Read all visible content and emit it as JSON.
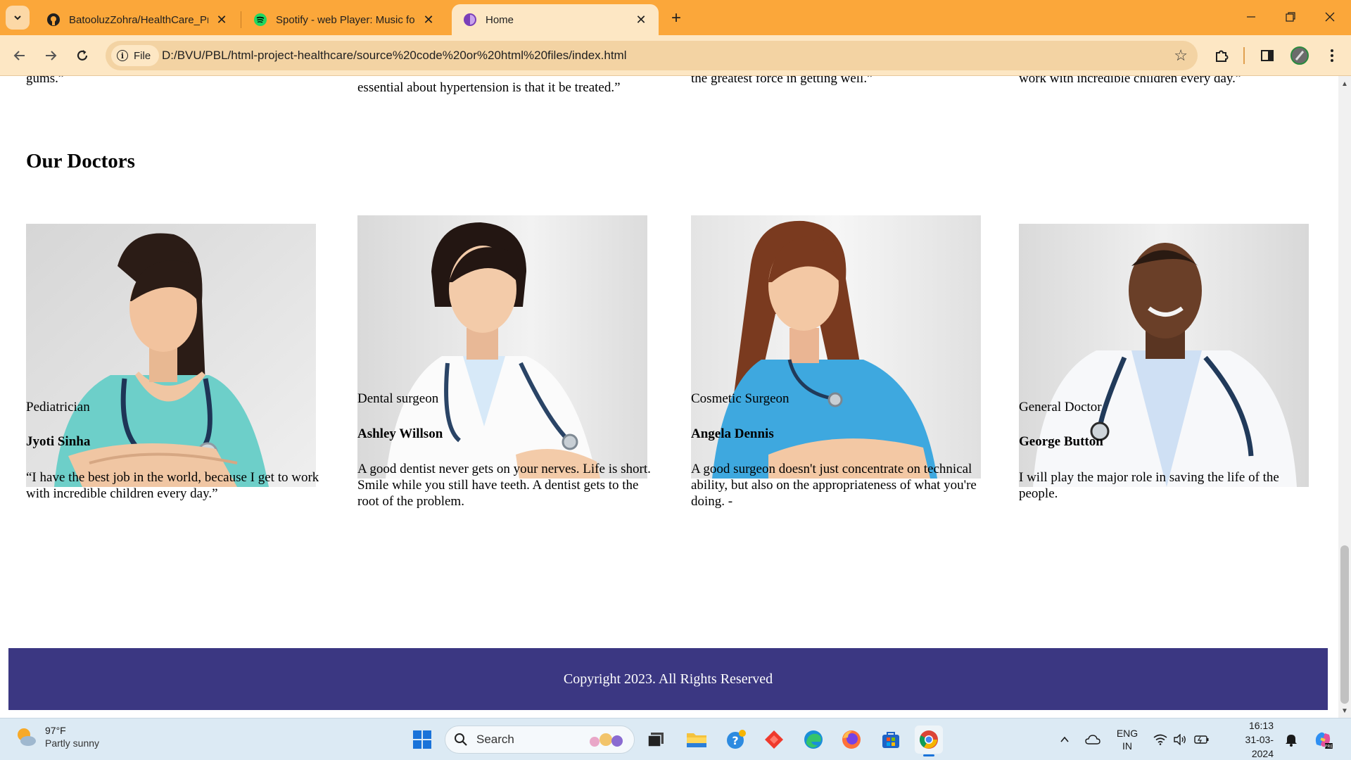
{
  "browser": {
    "tabs": [
      {
        "title": "BatooluzZohra/HealthCare_Pro",
        "icon": "github-icon"
      },
      {
        "title": "Spotify - web Player: Music for",
        "icon": "spotify-icon"
      },
      {
        "title": "Home",
        "icon": "page-favicon-icon"
      }
    ],
    "active_tab": 2,
    "site_chip": "File",
    "url": "D:/BVU/PBL/html-project-healthcare/source%20code%20or%20html%20files/index.html"
  },
  "page": {
    "previous_quotes": [
      "gums.”",
      "essential about hypertension is that it be treated.”",
      "the greatest force in getting well.”",
      "work with incredible children every day.”"
    ],
    "section_title": "Our Doctors",
    "doctors": [
      {
        "role": "Pediatrician",
        "name": "Jyoti Sinha",
        "quote": "“I have the best job in the world, because I get to work with incredible children every day.”",
        "scrub_color": "#6dcfc9"
      },
      {
        "role": "Dental surgeon",
        "name": "Ashley Willson",
        "quote": "A good dentist never gets on your nerves. Life is short. Smile while you still have teeth. A dentist gets to the root of the problem.",
        "scrub_color": "#ffffff"
      },
      {
        "role": "Cosmetic Surgeon",
        "name": "Angela Dennis",
        "quote": "A good surgeon doesn't just concentrate on technical ability, but also on the appropriateness of what you're doing. -",
        "scrub_color": "#3ea8df"
      },
      {
        "role": "General Doctor",
        "name": "George Button",
        "quote": "I will play the major role in saving the life of the people.",
        "scrub_color": "#ffffff"
      }
    ],
    "footer": "Copyright 2023. All Rights Reserved"
  },
  "taskbar": {
    "weather_temp": "97°F",
    "weather_desc": "Partly sunny",
    "search_placeholder": "Search",
    "lang_line1": "ENG",
    "lang_line2": "IN",
    "time": "16:13",
    "date": "31-03-2024"
  },
  "colors": {
    "tab_strip": "#fba73a",
    "toolbar": "#fde7c4",
    "footer": "#3b3782",
    "taskbar": "#dceaf4"
  }
}
